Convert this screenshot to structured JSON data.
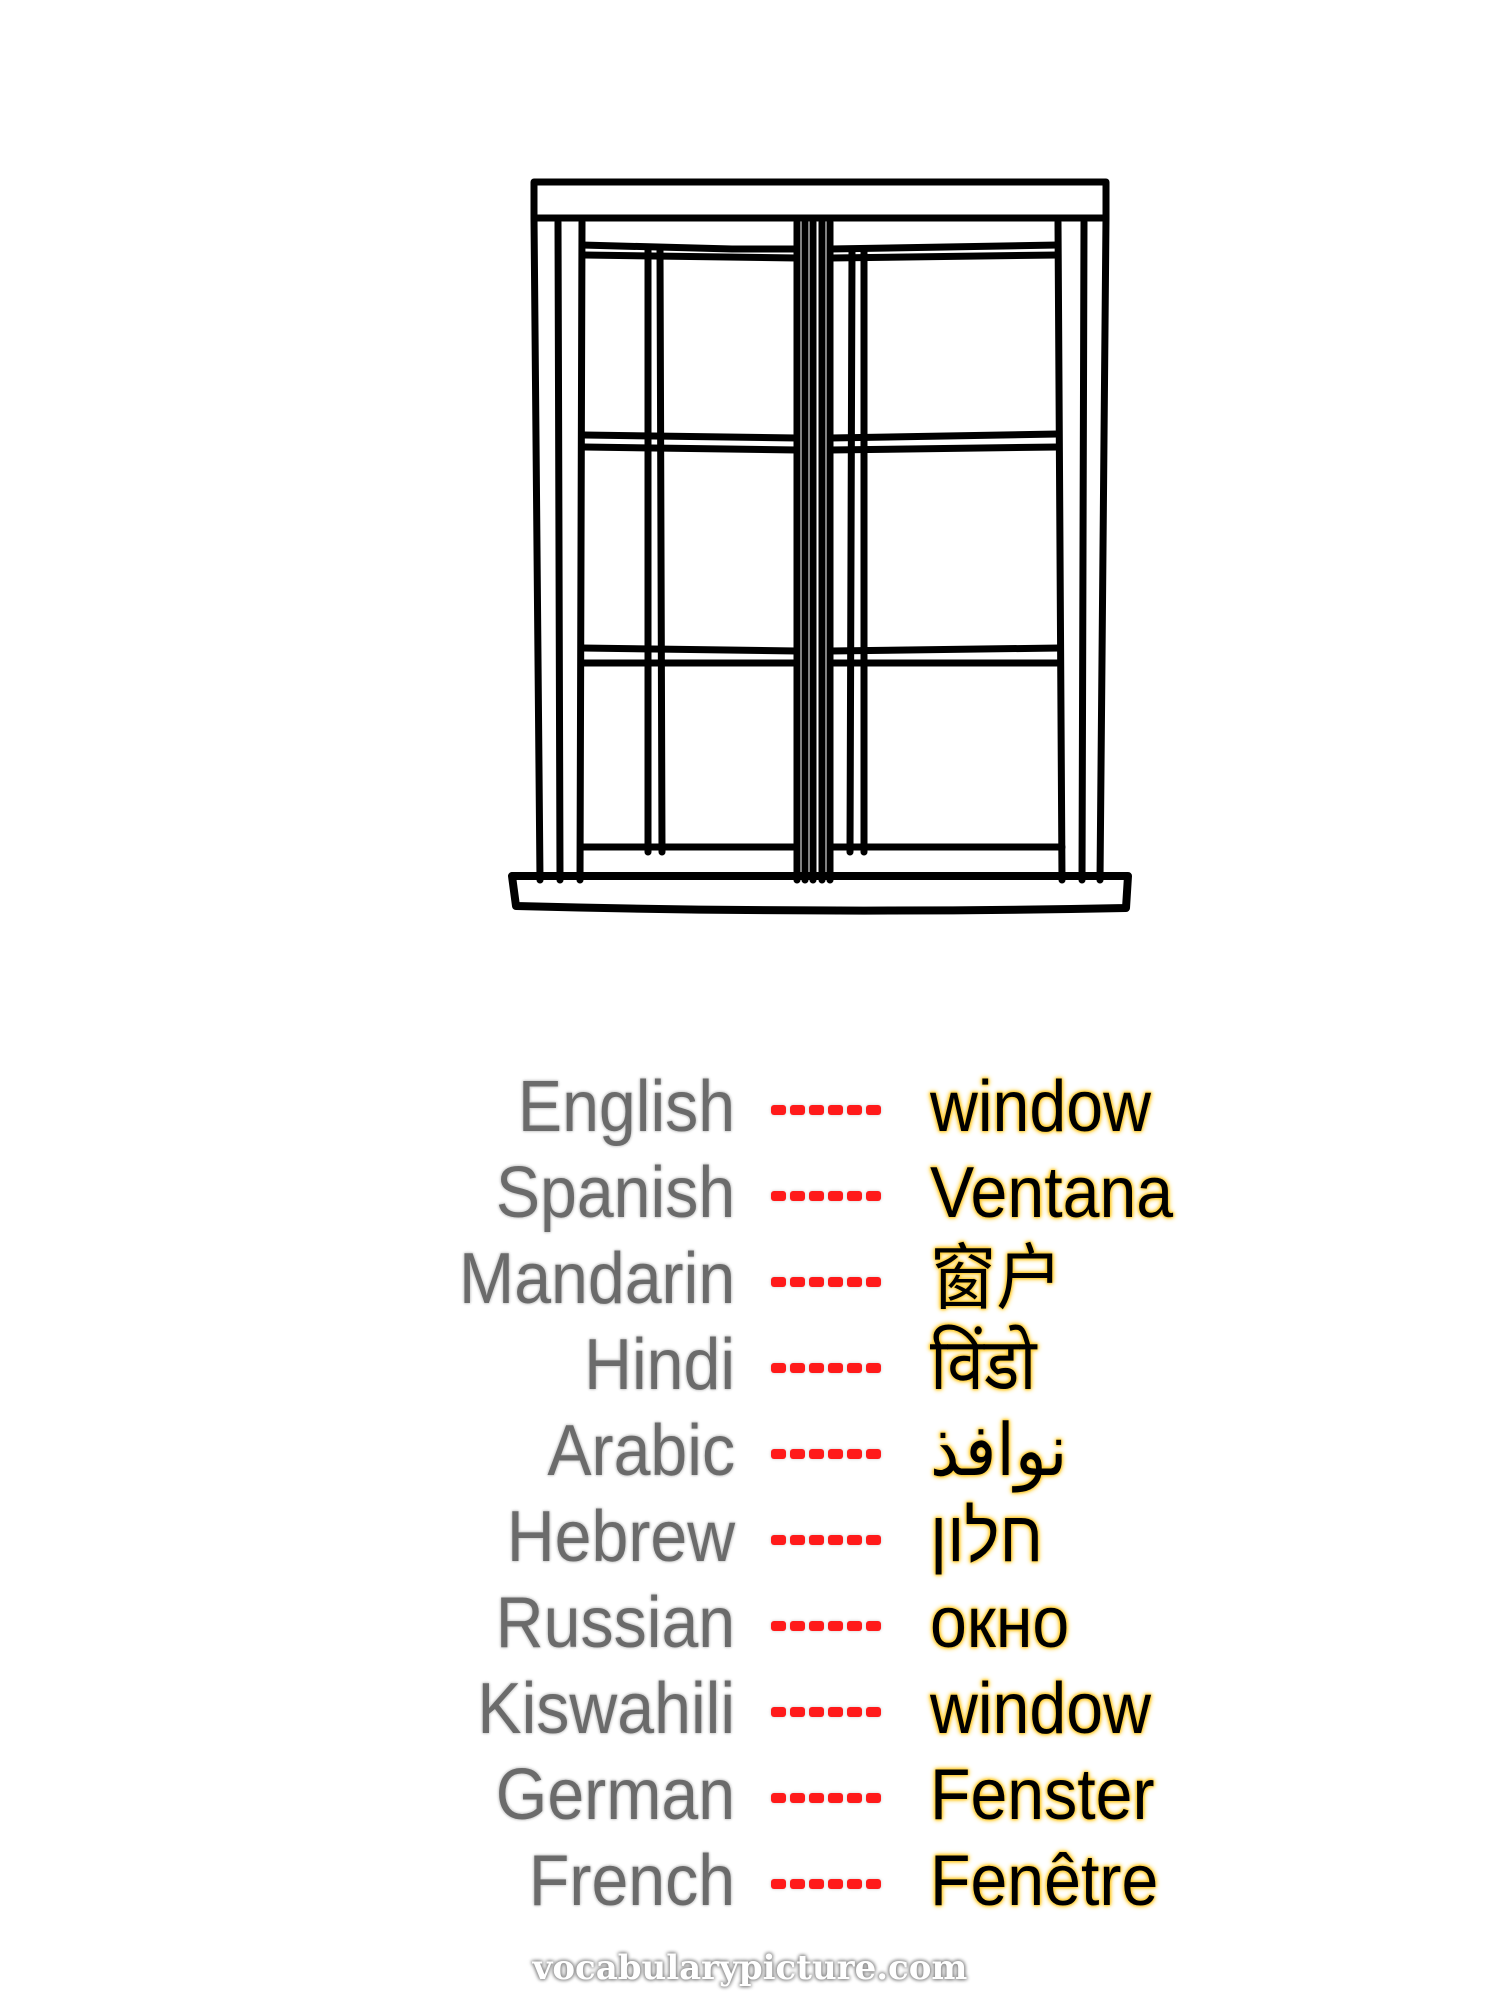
{
  "illustration": {
    "subject": "window",
    "icon": "window-icon",
    "stroke_color": "#000000"
  },
  "separator": {
    "label": "------",
    "color": "#ff1a1a"
  },
  "colors": {
    "language_label": "#6b6b6b",
    "translation_text": "#000000",
    "translation_glow": "#ffcc33"
  },
  "translations": [
    {
      "language": "English",
      "word": "window"
    },
    {
      "language": "Spanish",
      "word": "Ventana"
    },
    {
      "language": "Mandarin",
      "word": "窗户"
    },
    {
      "language": "Hindi",
      "word": "विंडो"
    },
    {
      "language": "Arabic",
      "word": "نوافذ"
    },
    {
      "language": "Hebrew",
      "word": "חלון"
    },
    {
      "language": "Russian",
      "word": "окно"
    },
    {
      "language": "Kiswahili",
      "word": "window"
    },
    {
      "language": "German",
      "word": "Fenster"
    },
    {
      "language": "French",
      "word": "Fenêtre"
    }
  ],
  "footer": {
    "watermark": "vocabularypicture.com"
  }
}
